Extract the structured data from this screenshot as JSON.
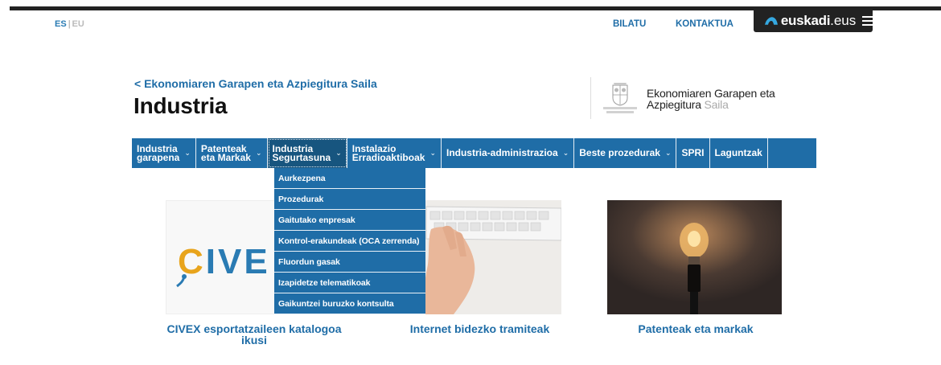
{
  "header": {
    "lang_active": "ES",
    "lang_sep": "|",
    "lang_other": "EU",
    "bilatu": "BILATU",
    "kontaktua": "KONTAKTUA",
    "brand_name": "euskadi",
    "brand_tld": ".eus"
  },
  "breadcrumb": "< Ekonomiaren Garapen eta Azpiegitura Saila",
  "page_title": "Industria",
  "department": {
    "line1": "Ekonomiaren Garapen eta",
    "line2": "Azpiegitura",
    "line2_suffix": "Saila"
  },
  "nav": {
    "items": [
      {
        "line1": "Industria",
        "line2": "garapena",
        "has_dropdown": true
      },
      {
        "line1": "Patenteak",
        "line2": "eta Markak",
        "has_dropdown": true
      },
      {
        "line1": "Industria",
        "line2": "Segurtasuna",
        "has_dropdown": true
      },
      {
        "line1": "Instalazio",
        "line2": "Erradioaktiboak",
        "has_dropdown": true
      },
      {
        "line1": "Industria-administrazioa",
        "line2": "",
        "has_dropdown": true
      },
      {
        "line1": "Beste prozedurak",
        "line2": "",
        "has_dropdown": true
      },
      {
        "line1": "SPRI",
        "line2": "",
        "has_dropdown": false
      },
      {
        "line1": "Laguntzak",
        "line2": "",
        "has_dropdown": false
      }
    ],
    "dropdown": [
      "Aurkezpena",
      "Prozedurak",
      "Gaitutako enpresak",
      "Kontrol-erakundeak (OCA zerrenda)",
      "Fluordun gasak",
      "Izapidetze telematikoak",
      "Gaikuntzei buruzko kontsulta"
    ]
  },
  "cards": [
    {
      "caption_line1": "CIVEX esportatzaileen katalogoa",
      "caption_line2": "ikusi",
      "logo_text": "CIVE"
    },
    {
      "caption_line1": "Internet bidezko tramiteak",
      "caption_line2": ""
    },
    {
      "caption_line1": "Patenteak eta markak",
      "caption_line2": ""
    }
  ],
  "colors": {
    "nav_blue": "#1f6da7",
    "link_blue": "#1f6da7",
    "civex_orange": "#e8a41c",
    "civex_blue": "#2a7bb3"
  }
}
